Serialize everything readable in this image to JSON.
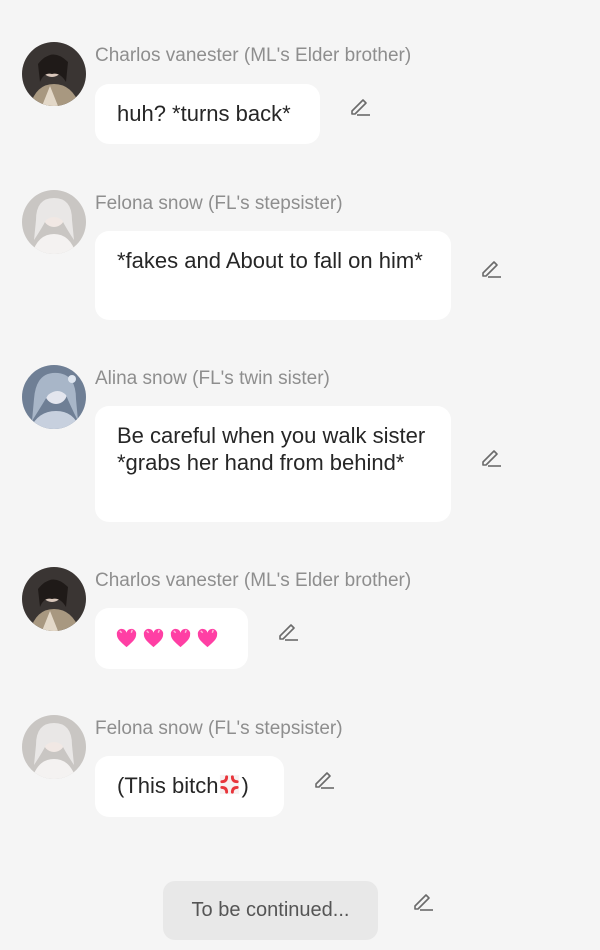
{
  "messages": [
    {
      "name": "Charlos vanester (ML's Elder brother)",
      "text": "huh? *turns back*",
      "avatar": "dark-haired-man-avatar"
    },
    {
      "name": "Felona snow (FL's stepsister)",
      "text": "*fakes and About to fall on him*",
      "avatar": "white-haired-woman-avatar"
    },
    {
      "name": "Alina snow (FL's twin sister)",
      "text": "Be careful when you walk sister *grabs her hand from behind*",
      "avatar": "blue-haired-woman-avatar"
    },
    {
      "name": "Charlos vanester (ML's Elder brother)",
      "emojis": [
        "pink-heart",
        "pink-heart",
        "pink-heart",
        "pink-heart"
      ],
      "avatar": "dark-haired-man-avatar"
    },
    {
      "name": "Felona snow (FL's stepsister)",
      "text_before": "(This bitch",
      "text_after": ")",
      "emoji": "anger-symbol",
      "avatar": "white-haired-woman-avatar"
    }
  ],
  "footer": {
    "label": "To be continued..."
  },
  "icons": {
    "edit": "pencil-icon"
  },
  "colors": {
    "background": "#f5f5f5",
    "bubble": "#ffffff",
    "name": "#8e8e8e",
    "heart": "#ff3fa4",
    "anger": "#e8353b"
  }
}
